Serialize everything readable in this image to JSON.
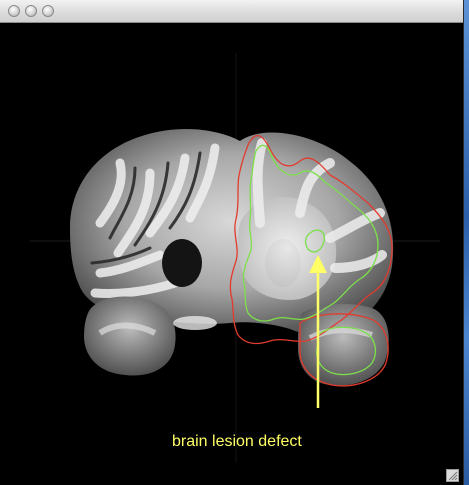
{
  "window": {
    "title": "",
    "buttons": [
      {
        "name": "close-button",
        "label": ""
      },
      {
        "name": "minimize-button",
        "label": ""
      },
      {
        "name": "zoom-button",
        "label": ""
      }
    ]
  },
  "viewer": {
    "image_subject": "coronal-brain-mri",
    "annotation_text": "brain lesion defect",
    "colors": {
      "annotation": "#ffff66",
      "outer_contour": "#e23b2e",
      "inner_contour": "#7de04a",
      "background": "#000000"
    }
  },
  "icons": {
    "resize": "resize-grip-icon"
  }
}
